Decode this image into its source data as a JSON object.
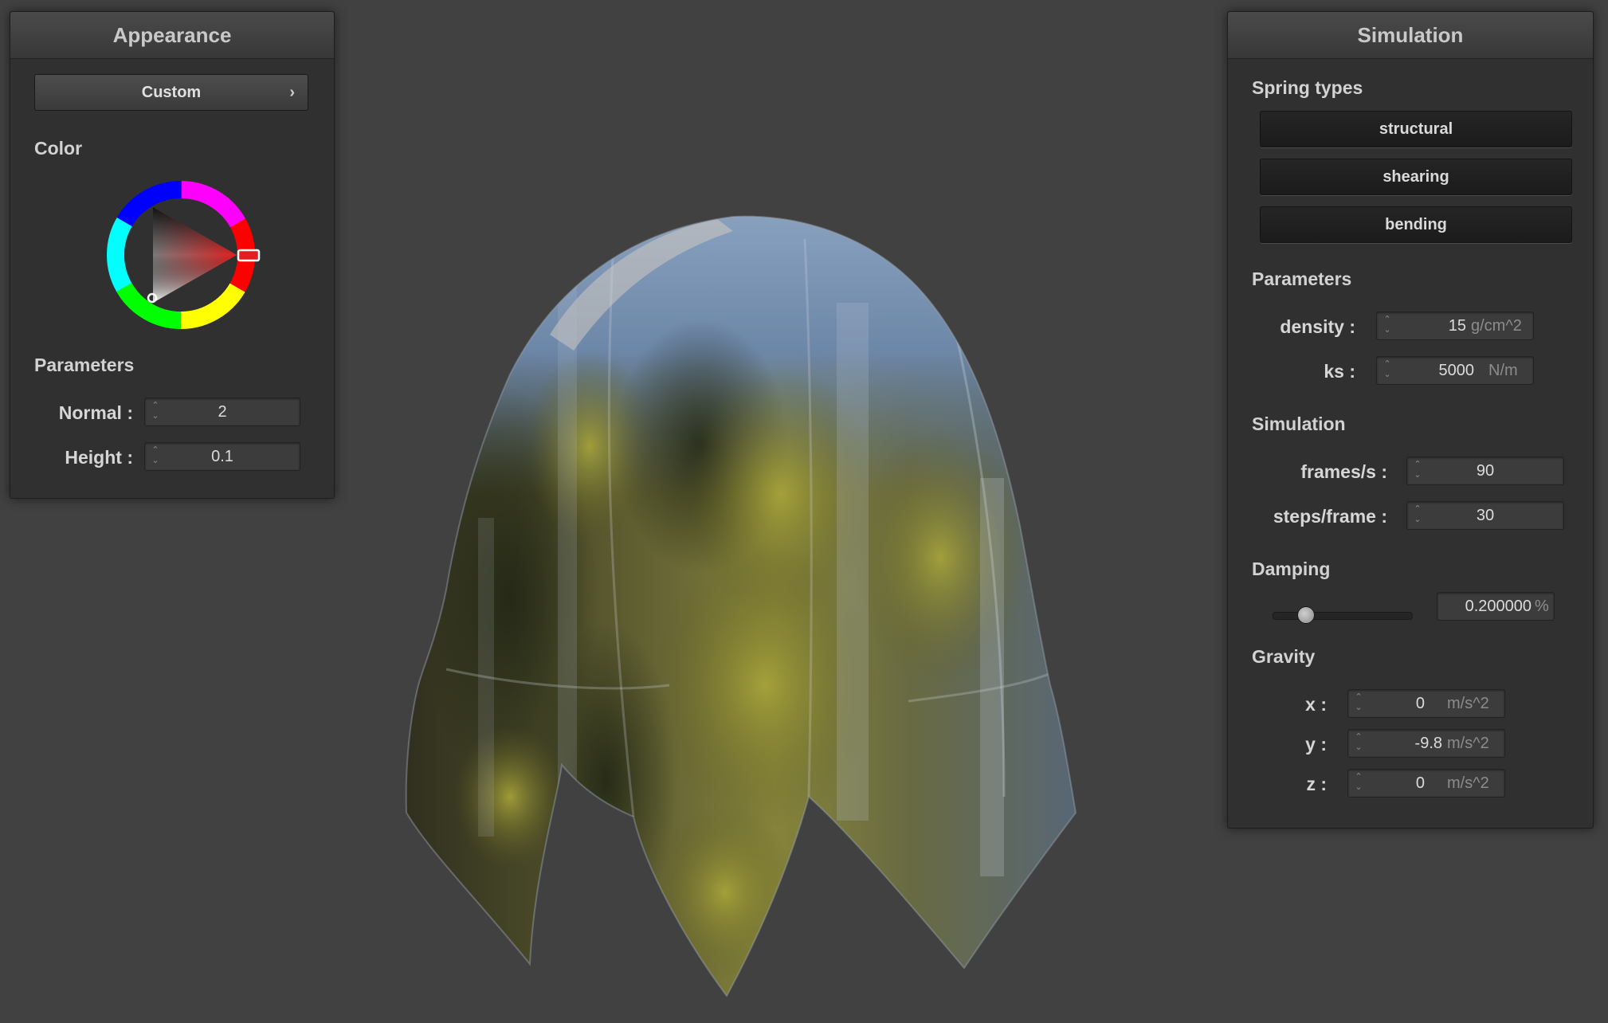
{
  "appearance_panel": {
    "title": "Appearance",
    "preset_button": "Custom",
    "color_label": "Color",
    "selected_color": "#e02020",
    "parameters_label": "Parameters",
    "normal_label": "Normal :",
    "normal_value": "2",
    "height_label": "Height :",
    "height_value": "0.1"
  },
  "simulation_panel": {
    "title": "Simulation",
    "spring_types_label": "Spring types",
    "spring_buttons": [
      "structural",
      "shearing",
      "bending"
    ],
    "parameters_label": "Parameters",
    "density_label": "density :",
    "density_value": "15",
    "density_unit": "g/cm^2",
    "ks_label": "ks :",
    "ks_value": "5000",
    "ks_unit": "N/m",
    "simulation_label": "Simulation",
    "fps_label": "frames/s :",
    "fps_value": "90",
    "steps_label": "steps/frame :",
    "steps_value": "30",
    "damping_label": "Damping",
    "damping_slider_fraction": 0.2,
    "damping_value": "0.200000",
    "damping_unit": "%",
    "gravity_label": "Gravity",
    "gravity_x_label": "x :",
    "gravity_x_value": "0",
    "gravity_y_label": "y :",
    "gravity_y_value": "-9.8",
    "gravity_z_label": "z :",
    "gravity_z_value": "0",
    "gravity_unit": "m/s^2"
  }
}
